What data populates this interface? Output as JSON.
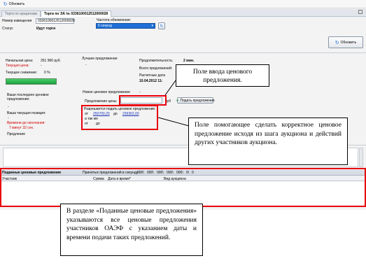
{
  "toolbar": {
    "refresh_label": "Обновить"
  },
  "tabs": [
    {
      "label": "Торги по аукционам"
    },
    {
      "label": "Торги по ЭА № 0336100012512000028"
    }
  ],
  "form": {
    "notice_label": "Номер извещения",
    "notice_value": "0336100012512000028",
    "status_label": "Статус",
    "status_value": "Идут торги",
    "refresh_freq_label": "Частота обновления:",
    "refresh_freq_value": "5 секунд",
    "refresh_button": "Обновить"
  },
  "left_panel": {
    "start_price_label": "Начальная цена:",
    "start_price_value": "251 960 руб.",
    "current_price_label": "Текущая цена:",
    "current_price_value": "-",
    "current_drop_label": "Текущее снижение:",
    "current_drop_value": "0 %",
    "progress": 1.0,
    "last_offer_label": "Ваше последнее ценовое предложение:",
    "last_offer_value": "-",
    "position_label": "Ваша текущая позиция:",
    "position_value": "-",
    "time_left_label": "Времени до окончания:",
    "time_left_value": "7 минут 32 сек.",
    "extension_label": "Продление"
  },
  "best_offer": {
    "label": "Лучшее предложение",
    "value": "-"
  },
  "right_info": {
    "duration_label": "Продолжительность:",
    "duration_value": "2 мин.",
    "total_label": "Всего предложений:",
    "calc_label": "Расчетные дата",
    "calc_value": "10.04.2012 11:"
  },
  "new_offer": {
    "section_label": "Новое ценовое предложение",
    "section_value": "-",
    "price_label": "Предложение цены",
    "price_value": "",
    "rub_label": "руб",
    "submit_button": "Подать предложение",
    "allowed_label": "Разрешается подать ценовое предложение:",
    "from_label": "от",
    "from_value": "250700,20",
    "to_label": "до",
    "to_value": "239362,00",
    "also_label": "а так же",
    "from2_label": "от",
    "to2_label": "до"
  },
  "submitted": {
    "title": "Поданные ценовые предложения",
    "accepted_label": "Принятых предложений в секунду:",
    "accepted_values": [
      "000\\",
      "000\\",
      "000\\",
      "000\\",
      "000\\",
      "0\\",
      "0"
    ],
    "columns": [
      "Участник",
      "Сумма",
      "Дата и время*",
      "Вид аукциона"
    ]
  },
  "callouts": {
    "input_field": "Поле ввода ценового предложения.",
    "helper_field": "Поле помогающее сделать корректное ценовое предложение исходя из шага аукциона и действий других участников аукциона.",
    "submitted_section": "В разделе «Поданные ценовые предложения» указываются все ценовые предложения участников ОАЭФ с указанием даты и времени подачи таких предложений."
  },
  "colors": {
    "accent_red": "#e8000b",
    "select_blue": "#1f6fd6",
    "progress_green": "#22b14c",
    "warning_red": "#d00000"
  }
}
